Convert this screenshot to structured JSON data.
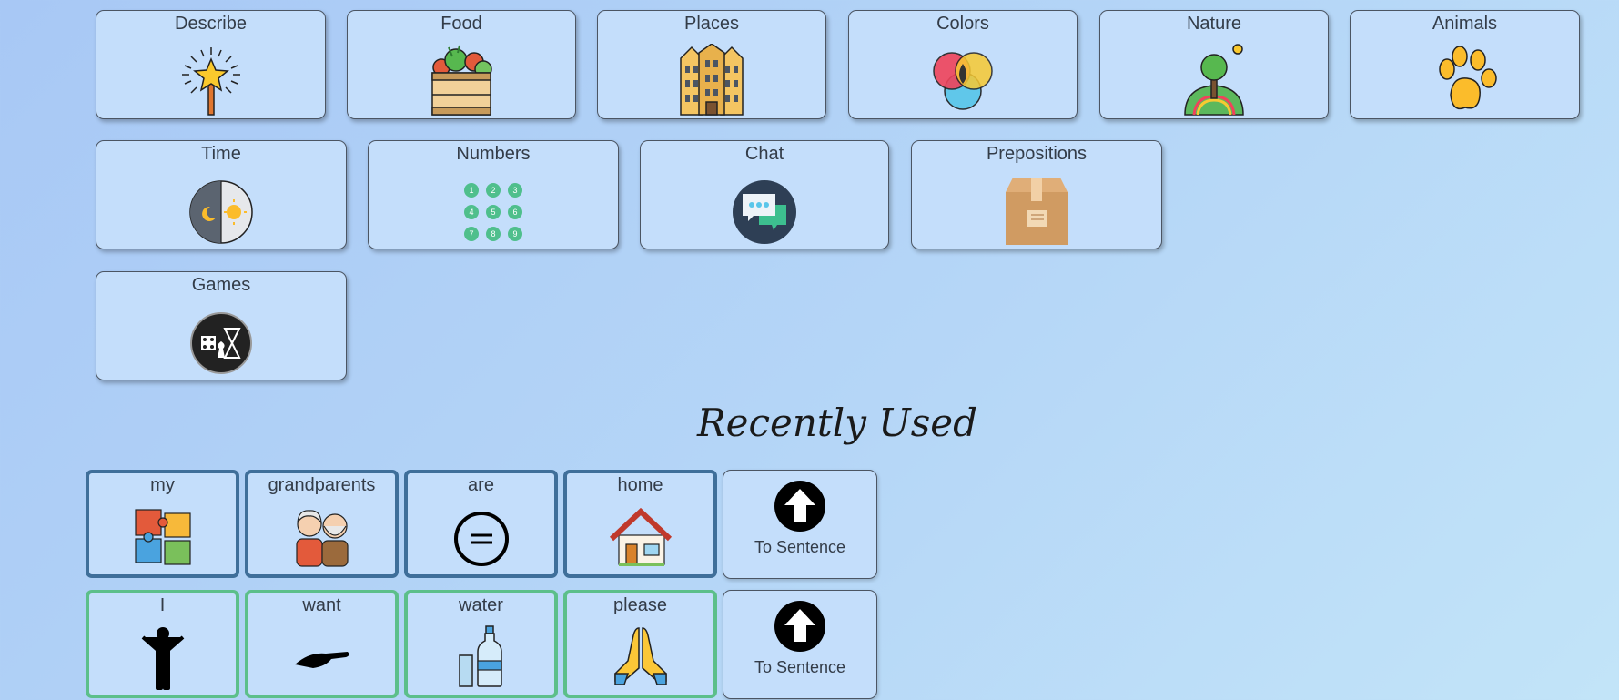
{
  "categories": [
    {
      "label": "Describe",
      "icon": "magic-wand-star-icon"
    },
    {
      "label": "Food",
      "icon": "vegetable-crate-icon"
    },
    {
      "label": "Places",
      "icon": "building-icon"
    },
    {
      "label": "Colors",
      "icon": "color-circles-icon"
    },
    {
      "label": "Nature",
      "icon": "tree-hill-icon"
    },
    {
      "label": "Animals",
      "icon": "paw-print-icon"
    },
    {
      "label": "Time",
      "icon": "day-night-icon"
    },
    {
      "label": "Numbers",
      "icon": "number-grid-icon"
    },
    {
      "label": "Chat",
      "icon": "chat-bubbles-icon"
    },
    {
      "label": "Prepositions",
      "icon": "cardboard-box-icon"
    },
    {
      "label": "Games",
      "icon": "board-game-icon"
    }
  ],
  "recent": {
    "title": "Recently Used",
    "to_sentence_label": "To Sentence",
    "rows": [
      {
        "words": [
          {
            "label": "my",
            "icon": "puzzle-pieces-icon"
          },
          {
            "label": "grandparents",
            "icon": "grandparents-icon"
          },
          {
            "label": "are",
            "icon": "equals-circle-icon"
          },
          {
            "label": "home",
            "icon": "house-icon"
          }
        ]
      },
      {
        "words": [
          {
            "label": "I",
            "icon": "person-icon"
          },
          {
            "label": "want",
            "icon": "open-hand-icon"
          },
          {
            "label": "water",
            "icon": "water-bottle-icon"
          },
          {
            "label": "please",
            "icon": "praying-hands-icon"
          }
        ]
      }
    ]
  },
  "colors": {
    "tile_bg": "#c4defb",
    "tile_border": "#4b5563",
    "row1_border": "#3f6f9a",
    "row2_border": "#5cbf8a"
  }
}
